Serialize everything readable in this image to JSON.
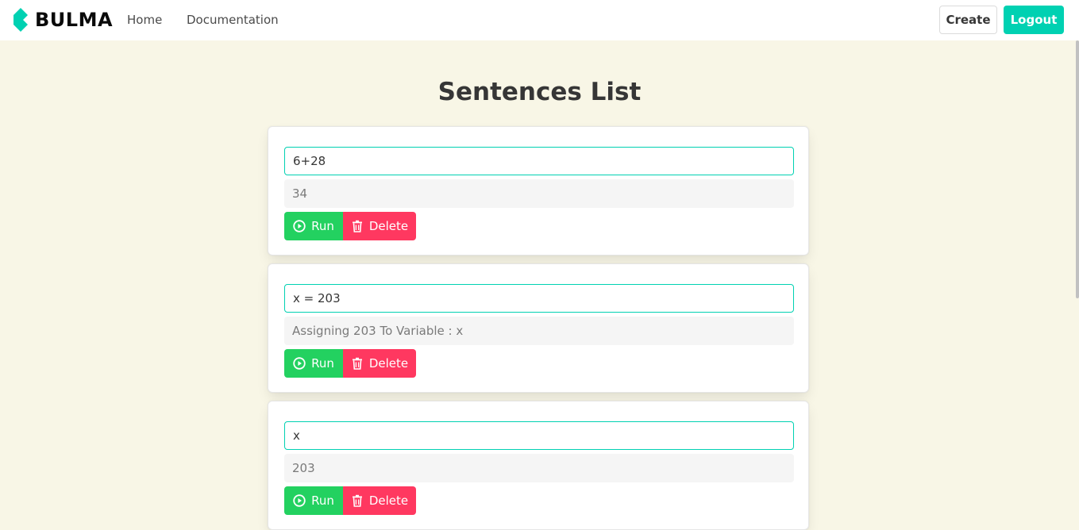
{
  "navbar": {
    "brand": "BULMA",
    "links": [
      "Home",
      "Documentation"
    ],
    "create_label": "Create",
    "logout_label": "Logout"
  },
  "colors": {
    "accent": "#00d1b2",
    "success": "#23d160",
    "danger": "#ff3860",
    "background": "#f8f6e6"
  },
  "page": {
    "title": "Sentences List"
  },
  "sentences": [
    {
      "input": "6+28",
      "result": "34",
      "run_label": "Run",
      "delete_label": "Delete"
    },
    {
      "input": "x = 203",
      "result": "Assigning 203 To Variable : x",
      "run_label": "Run",
      "delete_label": "Delete"
    },
    {
      "input": "x",
      "result": "203",
      "run_label": "Run",
      "delete_label": "Delete"
    }
  ],
  "icons": {
    "brand": "bulma-logo-icon",
    "run": "play-circle-icon",
    "delete": "trash-icon"
  }
}
